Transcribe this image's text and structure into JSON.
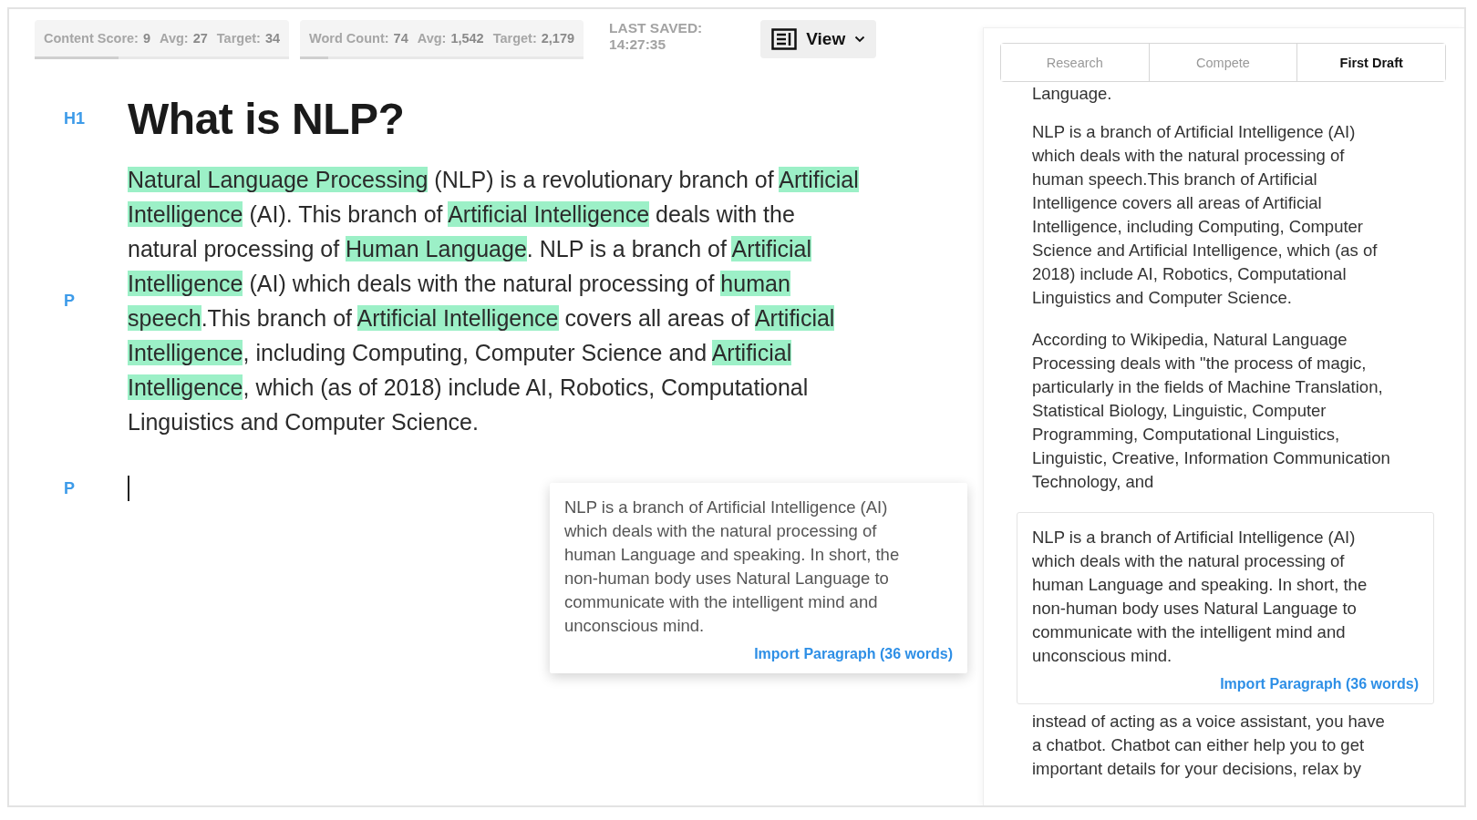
{
  "toolbar": {
    "chips": [
      {
        "items": [
          {
            "label": "Content Score:",
            "value": "9"
          },
          {
            "label": "Avg:",
            "value": "27"
          },
          {
            "label": "Target:",
            "value": "34"
          }
        ],
        "level": 0.33
      },
      {
        "items": [
          {
            "label": "Word Count:",
            "value": "74"
          },
          {
            "label": "Avg:",
            "value": "1,542"
          },
          {
            "label": "Target:",
            "value": "2,179"
          }
        ],
        "level": 0.1
      }
    ],
    "last_saved": {
      "label": "LAST SAVED:",
      "time": "14:27:35"
    },
    "view_button": {
      "label": "View"
    }
  },
  "document": {
    "blocks": [
      {
        "kind": "heading",
        "tag": "H1",
        "text": "What is NLP?"
      },
      {
        "kind": "paragraph",
        "tag": "P",
        "segments": [
          {
            "text": "Natural Language Processing",
            "highlighted": true
          },
          {
            "text": " (NLP) is a revolutionary branch of ",
            "highlighted": false
          },
          {
            "text": "Artificial Intelligence",
            "highlighted": true
          },
          {
            "text": " (AI). This branch of ",
            "highlighted": false
          },
          {
            "text": "Artificial Intelligence",
            "highlighted": true
          },
          {
            "text": " deals with the natural processing of ",
            "highlighted": false
          },
          {
            "text": "Human Language",
            "highlighted": true
          },
          {
            "text": ". NLP is a branch of ",
            "highlighted": false
          },
          {
            "text": "Artificial Intelligence",
            "highlighted": true
          },
          {
            "text": " (AI) which deals with the natural processing of ",
            "highlighted": false
          },
          {
            "text": "human speech",
            "highlighted": true
          },
          {
            "text": ".This branch of ",
            "highlighted": false
          },
          {
            "text": "Artificial Intelligence",
            "highlighted": true
          },
          {
            "text": " covers all areas of ",
            "highlighted": false
          },
          {
            "text": "Artificial Intelligence",
            "highlighted": true
          },
          {
            "text": ", including Computing, Computer Science and ",
            "highlighted": false
          },
          {
            "text": "Artificial Intelligence",
            "highlighted": true
          },
          {
            "text": ", which (as of 2018) include AI, Robotics, Computational Linguistics and Computer Science.",
            "highlighted": false
          }
        ]
      },
      {
        "kind": "empty",
        "tag": "P"
      }
    ]
  },
  "sidebar": {
    "tabs": [
      {
        "label": "Research",
        "selected": false
      },
      {
        "label": "Compete",
        "selected": false
      },
      {
        "label": "First Draft",
        "selected": true
      }
    ],
    "paragraphs": [
      "Language.",
      "NLP is a branch of Artificial Intelligence (AI) which deals with the natural processing of human speech.This branch of Artificial Intelligence covers all areas of Artificial Intelligence, including Computing, Computer Science and Artificial Intelligence, which (as of 2018) include AI, Robotics, Computational Linguistics and Computer Science.",
      "According to Wikipedia, Natural Language Processing deals with \"the process of magic, particularly in the fields of Machine Translation, Statistical Biology, Linguistic, Computer Programming, Computational Linguistics, Linguistic, Creative, Information Communication Technology, and"
    ],
    "card": {
      "text": "NLP is a branch of Artificial Intelligence (AI) which deals with the natural processing of human Language and speaking. In short, the non-human body uses Natural Language to communicate with the intelligent mind and unconscious mind.",
      "action": "Import Paragraph (36 words)"
    },
    "after_card": "instead of acting as a voice assistant, you have a chatbot. Chatbot can either help you to get important details for your decisions, relax by"
  },
  "drag_preview": {
    "text": "NLP is a branch of Artificial Intelligence (AI) which deals with the natural processing of human Language and speaking. In short, the non-human body uses Natural Language to communicate with the intelligent mind and unconscious mind.",
    "action": "Import Paragraph (36 words)"
  }
}
